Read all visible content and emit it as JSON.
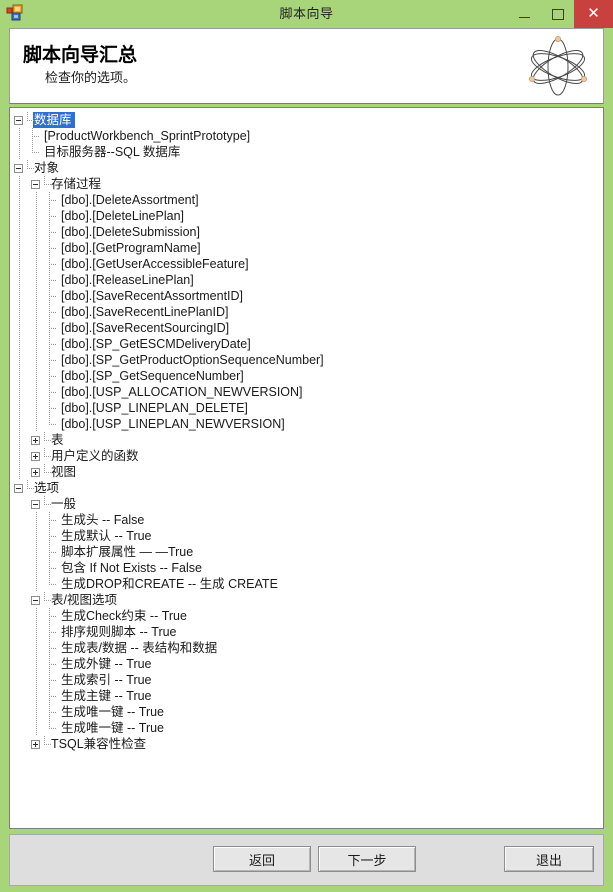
{
  "window": {
    "title": "脚本向导",
    "app_icon": "script-wizard-icon",
    "controls": {
      "minimize": "minimize-icon",
      "maximize": "maximize-icon",
      "close": "✕"
    },
    "colors": {
      "chrome": "#a8d47a",
      "close_button": "#c9413f",
      "selection": "#2f6fd0",
      "footer": "#dedede"
    }
  },
  "header": {
    "title": "脚本向导汇总",
    "subtitle": "检查你的选项。",
    "decoration_icon": "atom-icon"
  },
  "tree": {
    "nodes": [
      {
        "depth": 0,
        "toggle": "minus",
        "label": "数据库",
        "selected": true
      },
      {
        "depth": 1,
        "toggle": "leaf",
        "label": "[ProductWorkbench_SprintPrototype]"
      },
      {
        "depth": 1,
        "toggle": "leaf",
        "label": "目标服务器--SQL 数据库",
        "last": true
      },
      {
        "depth": 0,
        "toggle": "minus",
        "label": "对象"
      },
      {
        "depth": 1,
        "toggle": "minus",
        "label": "存储过程"
      },
      {
        "depth": 2,
        "toggle": "leaf",
        "label": "[dbo].[DeleteAssortment]"
      },
      {
        "depth": 2,
        "toggle": "leaf",
        "label": "[dbo].[DeleteLinePlan]"
      },
      {
        "depth": 2,
        "toggle": "leaf",
        "label": "[dbo].[DeleteSubmission]"
      },
      {
        "depth": 2,
        "toggle": "leaf",
        "label": "[dbo].[GetProgramName]"
      },
      {
        "depth": 2,
        "toggle": "leaf",
        "label": "[dbo].[GetUserAccessibleFeature]"
      },
      {
        "depth": 2,
        "toggle": "leaf",
        "label": "[dbo].[ReleaseLinePlan]"
      },
      {
        "depth": 2,
        "toggle": "leaf",
        "label": "[dbo].[SaveRecentAssortmentID]"
      },
      {
        "depth": 2,
        "toggle": "leaf",
        "label": "[dbo].[SaveRecentLinePlanID]"
      },
      {
        "depth": 2,
        "toggle": "leaf",
        "label": "[dbo].[SaveRecentSourcingID]"
      },
      {
        "depth": 2,
        "toggle": "leaf",
        "label": "[dbo].[SP_GetESCMDeliveryDate]"
      },
      {
        "depth": 2,
        "toggle": "leaf",
        "label": "[dbo].[SP_GetProductOptionSequenceNumber]"
      },
      {
        "depth": 2,
        "toggle": "leaf",
        "label": "[dbo].[SP_GetSequenceNumber]"
      },
      {
        "depth": 2,
        "toggle": "leaf",
        "label": "[dbo].[USP_ALLOCATION_NEWVERSION]"
      },
      {
        "depth": 2,
        "toggle": "leaf",
        "label": "[dbo].[USP_LINEPLAN_DELETE]"
      },
      {
        "depth": 2,
        "toggle": "leaf",
        "label": "[dbo].[USP_LINEPLAN_NEWVERSION]",
        "last": true
      },
      {
        "depth": 1,
        "toggle": "plus",
        "label": "表"
      },
      {
        "depth": 1,
        "toggle": "plus",
        "label": "用户定义的函数"
      },
      {
        "depth": 1,
        "toggle": "plus",
        "label": "视图",
        "last": true
      },
      {
        "depth": 0,
        "toggle": "minus",
        "label": "选项"
      },
      {
        "depth": 1,
        "toggle": "minus",
        "label": "一般"
      },
      {
        "depth": 2,
        "toggle": "leaf",
        "label": "生成头 -- False"
      },
      {
        "depth": 2,
        "toggle": "leaf",
        "label": "生成默认 -- True"
      },
      {
        "depth": 2,
        "toggle": "leaf",
        "label": "脚本扩展属性 — —True"
      },
      {
        "depth": 2,
        "toggle": "leaf",
        "label": "包含 If Not Exists -- False"
      },
      {
        "depth": 2,
        "toggle": "leaf",
        "label": "生成DROP和CREATE -- 生成 CREATE",
        "last": true
      },
      {
        "depth": 1,
        "toggle": "minus",
        "label": "表/视图选项"
      },
      {
        "depth": 2,
        "toggle": "leaf",
        "label": "生成Check约束 -- True"
      },
      {
        "depth": 2,
        "toggle": "leaf",
        "label": "排序规则脚本 -- True"
      },
      {
        "depth": 2,
        "toggle": "leaf",
        "label": "生成表/数据 -- 表结构和数据"
      },
      {
        "depth": 2,
        "toggle": "leaf",
        "label": "生成外键 -- True"
      },
      {
        "depth": 2,
        "toggle": "leaf",
        "label": "生成索引 -- True"
      },
      {
        "depth": 2,
        "toggle": "leaf",
        "label": "生成主键 -- True"
      },
      {
        "depth": 2,
        "toggle": "leaf",
        "label": "生成唯一键 -- True"
      },
      {
        "depth": 2,
        "toggle": "leaf",
        "label": "生成唯一键 -- True",
        "last": true
      },
      {
        "depth": 1,
        "toggle": "plus",
        "label": "TSQL兼容性检查",
        "last": true
      }
    ]
  },
  "footer": {
    "back": "返回",
    "next": "下一步",
    "exit": "退出"
  }
}
